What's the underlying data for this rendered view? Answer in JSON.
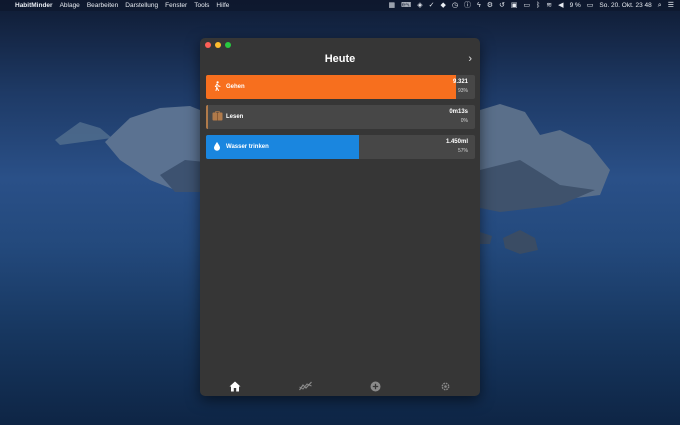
{
  "menubar": {
    "app_name": "HabitMinder",
    "menus": [
      "Ablage",
      "Bearbeiten",
      "Darstellung",
      "Fenster",
      "Tools",
      "Hilfe"
    ],
    "battery": "9 %",
    "clock": "So. 20. Okt.  23 48"
  },
  "window": {
    "title": "Heute",
    "habits": [
      {
        "name": "Gehen",
        "value": "9.321",
        "percent": "93%",
        "progress": 0.93,
        "color": "#f76f1e",
        "icon": "walking-person-icon"
      },
      {
        "name": "Lesen",
        "value": "0m13s",
        "percent": "0%",
        "progress": 0.0,
        "color": "#b07a4a",
        "icon": "book-icon"
      },
      {
        "name": "Wasser trinken",
        "value": "1.450ml",
        "percent": "57%",
        "progress": 0.57,
        "color": "#1a86df",
        "icon": "water-drop-icon"
      }
    ],
    "tabs": [
      "home-icon",
      "chart-icon",
      "add-icon",
      "settings-icon"
    ]
  }
}
